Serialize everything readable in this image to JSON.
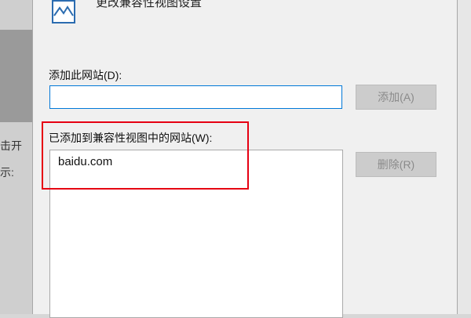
{
  "dialog": {
    "title": "更改兼容性视图设置",
    "add_site_label": "添加此网站(D):",
    "add_site_input_value": "",
    "add_button_label": "添加(A)",
    "added_sites_label": "已添加到兼容性视图中的网站(W):",
    "added_sites": [
      "baidu.com"
    ],
    "remove_button_label": "删除(R)"
  },
  "background": {
    "text_line_1": "击开",
    "text_line_2": "示:"
  },
  "colors": {
    "highlight": "#e60012",
    "focus_border": "#0078d7",
    "disabled_button_bg": "#cccccc"
  },
  "icons": {
    "header": "compatibility-view-icon"
  }
}
